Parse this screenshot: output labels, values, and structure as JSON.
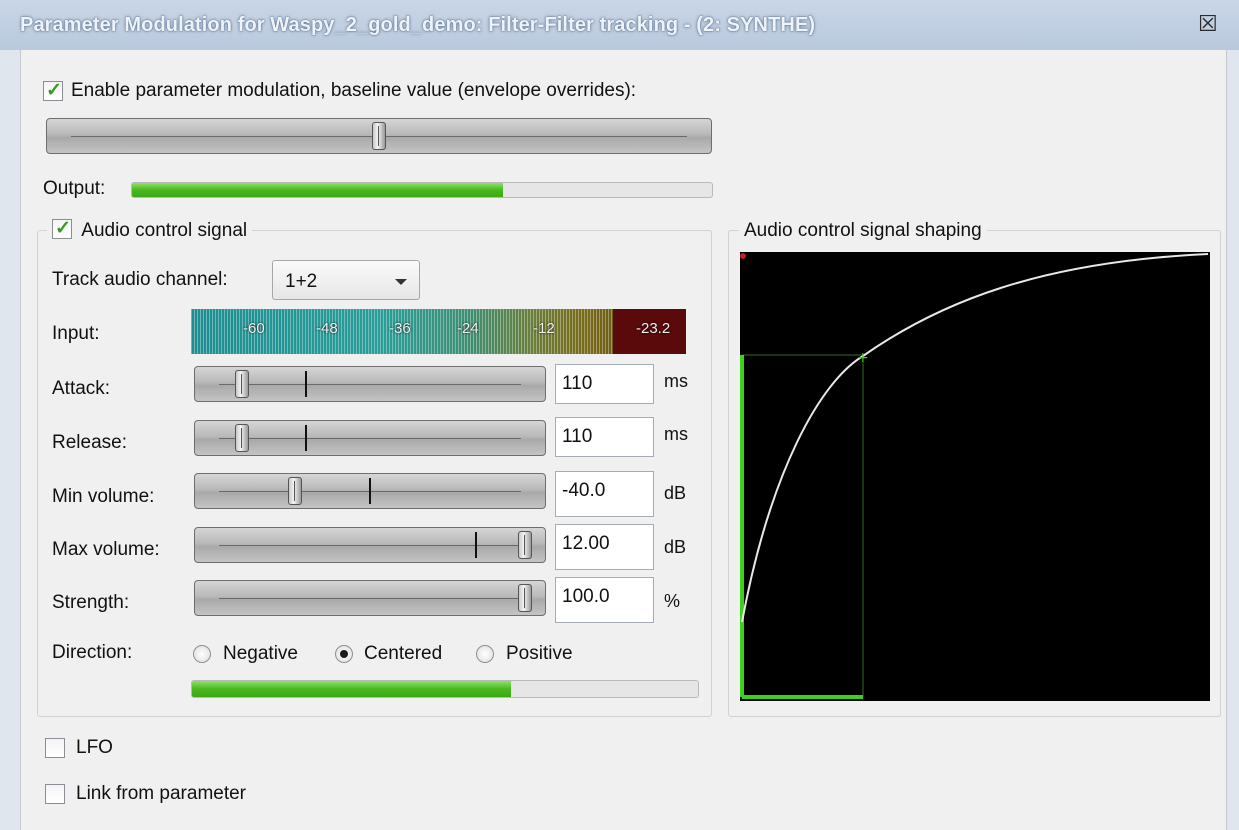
{
  "window": {
    "title": "Parameter Modulation for Waspy_2_gold_demo: Filter-Filter tracking - (2: SYNTHE)",
    "close_glyph": "☒"
  },
  "enable_modulation": {
    "label": "Enable parameter modulation, baseline value (envelope overrides):",
    "checked": true,
    "baseline_position": 0.5
  },
  "output": {
    "label": "Output:",
    "level": 0.64
  },
  "audio_control": {
    "label": "Audio control signal",
    "checked": true,
    "track_channel": {
      "label": "Track audio channel:",
      "value": "1+2"
    },
    "input": {
      "label": "Input:",
      "scale_labels": [
        "-60",
        "-48",
        "-36",
        "-24",
        "-12"
      ],
      "peak": "-23.2"
    },
    "attack": {
      "label": "Attack:",
      "value": "110",
      "unit": "ms",
      "position": 0.1
    },
    "release": {
      "label": "Release:",
      "value": "110",
      "unit": "ms",
      "position": 0.1
    },
    "min_volume": {
      "label": "Min volume:",
      "value": "-40.0",
      "unit": "dB",
      "position": 0.3
    },
    "max_volume": {
      "label": "Max volume:",
      "value": "12.00",
      "unit": "dB",
      "position": 1.0
    },
    "strength": {
      "label": "Strength:",
      "value": "100.0",
      "unit": "%",
      "position": 1.0
    },
    "direction": {
      "label": "Direction:",
      "options": [
        "Negative",
        "Centered",
        "Positive"
      ],
      "selected": "Centered"
    },
    "level": 0.63
  },
  "shaping": {
    "label": "Audio control signal shaping"
  },
  "lfo": {
    "label": "LFO",
    "checked": false
  },
  "link": {
    "label": "Link from parameter",
    "checked": false
  },
  "colors": {
    "accent_green": "#3aa813",
    "graph_bg": "#000000",
    "peak_red": "#5a0a0a"
  },
  "icons": [
    "close-icon",
    "checkmark-icon",
    "dropdown-arrow-icon"
  ]
}
